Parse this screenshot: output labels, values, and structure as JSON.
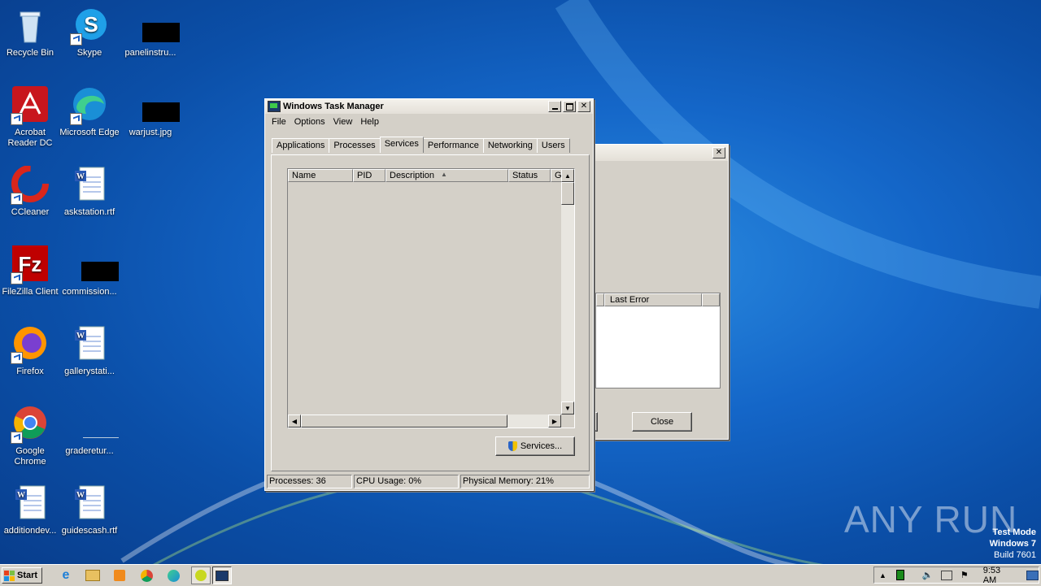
{
  "desktop": {
    "icons": [
      {
        "label": "Recycle Bin",
        "icon": "recycle-bin-icon"
      },
      {
        "label": "Skype",
        "icon": "skype-icon"
      },
      {
        "label": "panelinstru...",
        "icon": "hidden-file-icon"
      },
      {
        "label": "Acrobat Reader DC",
        "icon": "acrobat-icon"
      },
      {
        "label": "Microsoft Edge",
        "icon": "edge-icon"
      },
      {
        "label": "warjust.jpg",
        "icon": "hidden-file-icon"
      },
      {
        "label": "CCleaner",
        "icon": "ccleaner-icon"
      },
      {
        "label": "askstation.rtf",
        "icon": "word-document-icon"
      },
      {
        "label": "FileZilla Client",
        "icon": "filezilla-icon"
      },
      {
        "label": "commission...",
        "icon": "hidden-file-icon"
      },
      {
        "label": "Firefox",
        "icon": "firefox-icon"
      },
      {
        "label": "gallerystati...",
        "icon": "word-document-icon"
      },
      {
        "label": "Google Chrome",
        "icon": "chrome-icon"
      },
      {
        "label": "graderetur...",
        "icon": "blank-file-icon"
      },
      {
        "label": "additiondev...",
        "icon": "word-document-icon"
      },
      {
        "label": "guidescash.rtf",
        "icon": "word-document-icon"
      }
    ]
  },
  "task_manager": {
    "title": "Windows Task Manager",
    "menu": [
      "File",
      "Options",
      "View",
      "Help"
    ],
    "tabs": [
      "Applications",
      "Processes",
      "Services",
      "Performance",
      "Networking",
      "Users"
    ],
    "active_tab": "Services",
    "columns": [
      "Name",
      "PID",
      "Description",
      "Status",
      "G"
    ],
    "services_button": "Services...",
    "status": {
      "processes": "Processes: 36",
      "cpu": "CPU Usage: 0%",
      "memory": "Physical Memory: 21%"
    }
  },
  "back_dialog": {
    "column": "Last Error",
    "close_button": "Close"
  },
  "watermark": {
    "brand": "ANY RUN",
    "line1": "Test Mode",
    "line2": "Windows 7",
    "line3": "Build 7601"
  },
  "taskbar": {
    "start_label": "Start",
    "clock": "9:53 AM"
  }
}
